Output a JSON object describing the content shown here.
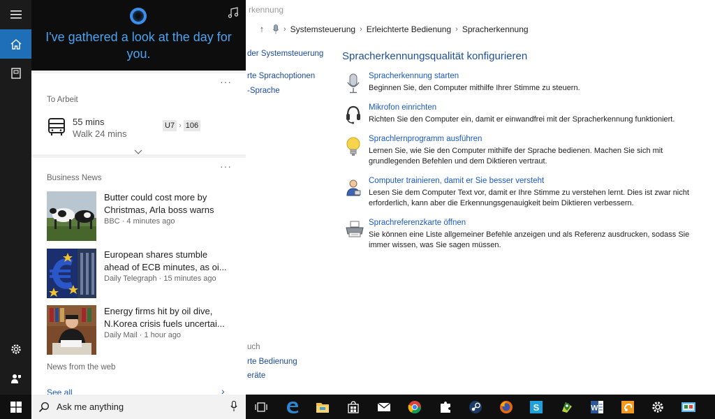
{
  "window": {
    "title": "Spracherkennung",
    "title_visible": "rkennung",
    "breadcrumb": [
      "Systemsteuerung",
      "Erleichterte Bedienung",
      "Spracherkennung"
    ]
  },
  "left_links": {
    "home": "der Systemsteuerung",
    "options": "rte Sprachoptionen",
    "text": "-Sprache",
    "see_also": "uch",
    "ease": "rte Bedienung",
    "devices": "eräte"
  },
  "main": {
    "heading": "Spracherkennungsqualität konfigurieren",
    "items": [
      {
        "link": "Spracherkennung starten",
        "desc": "Beginnen Sie, den Computer mithilfe Ihrer Stimme zu steuern.",
        "icon": "microphone-icon"
      },
      {
        "link": "Mikrofon einrichten",
        "desc": "Richten Sie den Computer ein, damit er einwandfrei mit der Spracherkennung funktioniert.",
        "icon": "headset-icon"
      },
      {
        "link": "Sprachlernprogramm ausführen",
        "desc": "Lernen Sie, wie Sie den Computer mithilfe der Sprache bedienen. Machen Sie sich mit grundlegenden Befehlen und dem Diktieren vertraut.",
        "icon": "lightbulb-icon"
      },
      {
        "link": "Computer trainieren, damit er Sie besser versteht",
        "desc": "Lesen Sie dem Computer Text vor, damit er Ihre Stimme zu verstehen lernt. Dies ist zwar nicht erforderlich, kann aber die Erkennungsgenauigkeit beim Diktieren verbessern.",
        "icon": "user-train-icon"
      },
      {
        "link": "Sprachreferenzkarte öffnen",
        "desc": "Sie können eine Liste allgemeiner Befehle anzeigen und als Referenz ausdrucken, sodass Sie immer wissen, was Sie sagen müssen.",
        "icon": "printer-icon"
      }
    ]
  },
  "cortana": {
    "greeting": "I've gathered a look at the day for you.",
    "commute": {
      "label": "To Arbeit",
      "duration": "55 mins",
      "walk": "Walk 24 mins",
      "route_from": "U7",
      "route_to": "106"
    },
    "news": {
      "label": "Business News",
      "items": [
        {
          "headline": "Butter could cost more by Christmas, Arla boss warns",
          "meta": "BBC · 4 minutes ago"
        },
        {
          "headline": "European shares stumble ahead of ECB minutes, as oi...",
          "meta": "Daily Telegraph · 15 minutes ago"
        },
        {
          "headline": "Energy firms hit by oil dive, N.Korea crisis fuels uncertai...",
          "meta": "Daily Mail · 1 hour ago"
        }
      ],
      "web_label": "News from the web",
      "see_all": "See all"
    },
    "dots": "···"
  },
  "search": {
    "placeholder": "Ask me anything"
  },
  "colors": {
    "accent": "#1f6fb8",
    "cortana_blue": "#4aa3f0",
    "link_blue": "#1a59c4"
  }
}
